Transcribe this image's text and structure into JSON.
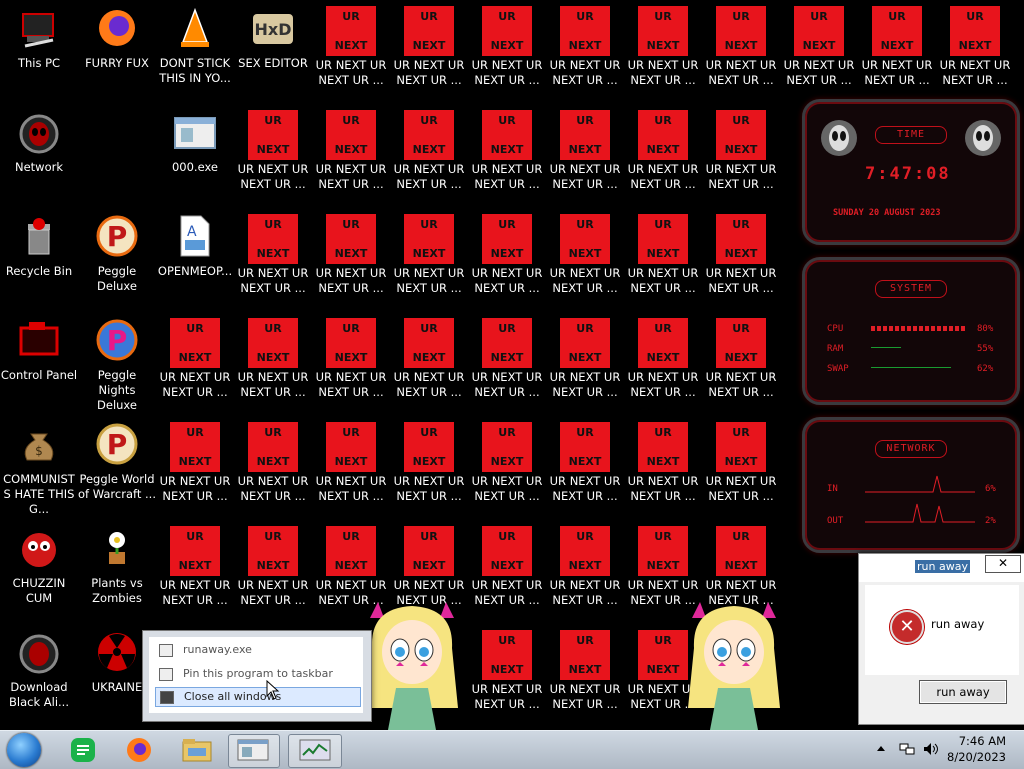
{
  "desktop": {
    "ur_label": "UR NEXT UR NEXT UR ...",
    "ur_badge": {
      "top": "UR",
      "bottom": "NEXT"
    },
    "left_icons": [
      {
        "name": "this-pc",
        "label": "This PC"
      },
      {
        "name": "network",
        "label": "Network"
      },
      {
        "name": "recycle-bin",
        "label": "Recycle Bin"
      },
      {
        "name": "control-panel",
        "label": "Control Panel"
      },
      {
        "name": "communists",
        "label": "COMMUNISTS HATE THIS G..."
      },
      {
        "name": "chuzzin",
        "label": "CHUZZIN CUM"
      },
      {
        "name": "download-black",
        "label": "Download Black Ali..."
      }
    ],
    "col2_icons": [
      {
        "name": "furry-fux",
        "label": "FURRY FUX"
      },
      {
        "name": "peggle-deluxe",
        "label": "Peggle Deluxe"
      },
      {
        "name": "peggle-nights",
        "label": "Peggle Nights Deluxe"
      },
      {
        "name": "peggle-world",
        "label": "Peggle World of Warcraft ..."
      },
      {
        "name": "plants-vs-zombies",
        "label": "Plants vs Zombies"
      },
      {
        "name": "ukraine",
        "label": "UKRAINE"
      }
    ],
    "col3_icons": [
      {
        "name": "dont-stick",
        "label": "DONT STICK THIS IN YO..."
      },
      {
        "name": "exe-000",
        "label": "000.exe"
      },
      {
        "name": "openmeop",
        "label": "OPENMEOP..."
      }
    ],
    "col4_icons": [
      {
        "name": "sex-editor",
        "label": "SEX EDITOR"
      }
    ]
  },
  "gadget": {
    "time_title": "TIME",
    "time": "7:47:08",
    "date": "SUNDAY 20 AUGUST 2023",
    "system_title": "SYSTEM",
    "cpu_label": "CPU",
    "cpu_value": "80%",
    "ram_label": "RAM",
    "ram_value": "55%",
    "swap_label": "SWAP",
    "swap_value": "62%",
    "network_title": "NETWORK",
    "in_label": "IN",
    "in_value": "6%",
    "out_label": "OUT",
    "out_value": "2%"
  },
  "popup": {
    "title": "run away",
    "message": "run away",
    "button": "run away",
    "close_glyph": "✕"
  },
  "jumplist": {
    "items": [
      "runaway.exe",
      "Pin this program to taskbar",
      "Close all windows"
    ]
  },
  "taskbar": {
    "time": "7:46 AM",
    "date": "8/20/2023"
  },
  "colors": {
    "accent_red": "#e8141c",
    "gadget_red": "#e01e26"
  }
}
